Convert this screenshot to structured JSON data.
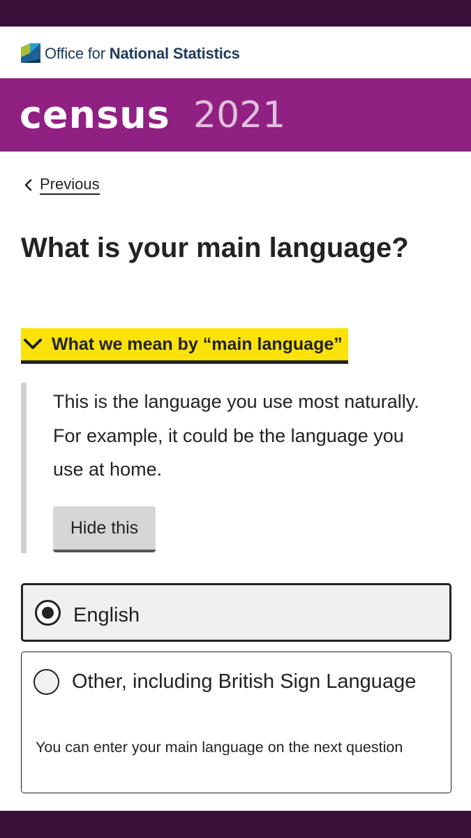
{
  "header": {
    "org_name_prefix": "Office for ",
    "org_name_bold": "National Statistics",
    "logo_icon": "ons-logo-icon",
    "brand_word": "census",
    "brand_year": "2021",
    "colors": {
      "top_bar": "#3b1038",
      "brand_band": "#902082",
      "brand_year": "#e0bfdc",
      "org_text": "#1f3a5c"
    }
  },
  "nav": {
    "previous_label": "Previous",
    "previous_icon": "chevron-left-icon"
  },
  "question": {
    "title": "What is your main language?"
  },
  "details": {
    "toggle_label": "What we mean by “main language”",
    "toggle_icon": "chevron-down-icon",
    "expanded": true,
    "body": "This is the language you use most naturally. For example, it could be the language you use at home.",
    "hide_button_label": "Hide this",
    "colors": {
      "toggle_bg": "#fbe20a",
      "panel_border": "#d0d0d0"
    }
  },
  "answers": {
    "options": [
      {
        "label": "English",
        "selected": true,
        "hint": ""
      },
      {
        "label": "Other, including British Sign Language",
        "selected": false,
        "hint": "You can enter your main language on the next question"
      }
    ]
  }
}
